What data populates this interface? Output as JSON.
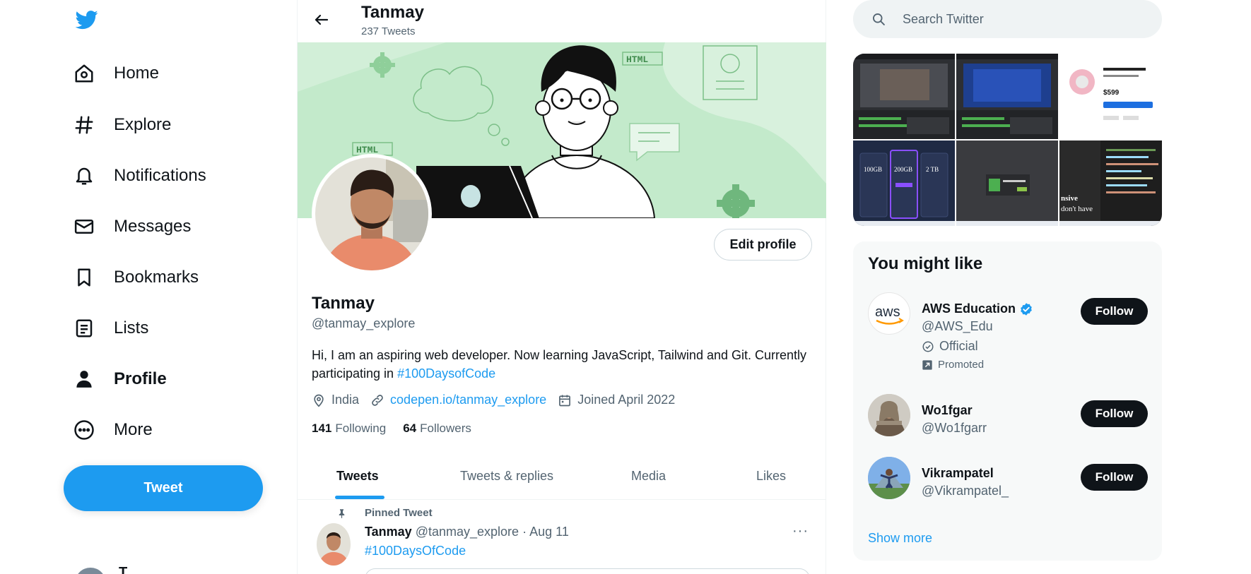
{
  "colors": {
    "accent": "#1d9bf0",
    "text": "#0f1419",
    "secondary_text": "#536471",
    "banner": "#c3eacb",
    "follow_button": "#0f1419"
  },
  "sidebar": {
    "logo_icon": "twitter-bird-icon",
    "items": [
      {
        "label": "Home",
        "icon": "home-icon"
      },
      {
        "label": "Explore",
        "icon": "hashtag-icon"
      },
      {
        "label": "Notifications",
        "icon": "bell-icon"
      },
      {
        "label": "Messages",
        "icon": "envelope-icon"
      },
      {
        "label": "Bookmarks",
        "icon": "bookmark-icon"
      },
      {
        "label": "Lists",
        "icon": "list-icon"
      },
      {
        "label": "Profile",
        "icon": "person-icon",
        "active": true
      },
      {
        "label": "More",
        "icon": "more-circle-icon"
      }
    ],
    "tweet_button": "Tweet",
    "account_name": "T"
  },
  "header": {
    "title": "Tanmay",
    "subtitle": "237 Tweets"
  },
  "banner_text": {
    "tag_1": "HTML",
    "tag_2": "HTML"
  },
  "profile": {
    "name": "Tanmay",
    "handle": "@tanmay_explore",
    "bio_text": "Hi, I am an aspiring web developer. Now learning JavaScript, Tailwind and Git. Currently participating in ",
    "bio_hashtag": "#100DaysofCode",
    "location": "India",
    "website": "codepen.io/tanmay_explore",
    "joined": "Joined April 2022",
    "following_count": "141",
    "following_label": "Following",
    "followers_count": "64",
    "followers_label": "Followers",
    "edit_button": "Edit profile"
  },
  "tabs": [
    {
      "label": "Tweets",
      "active": true
    },
    {
      "label": "Tweets & replies"
    },
    {
      "label": "Media"
    },
    {
      "label": "Likes"
    }
  ],
  "pinned_tweet": {
    "pinned_label": "Pinned Tweet",
    "author": "Tanmay",
    "handle": "@tanmay_explore",
    "separator": "·",
    "date": "Aug 11",
    "text": "#100DaysOfCode",
    "more": "···"
  },
  "search": {
    "placeholder": "Search Twitter"
  },
  "media_thumbs": {
    "price": "$599",
    "pricing_1": "100GB",
    "pricing_2": "200GB",
    "pricing_3": "2 TB",
    "snippet_1": "nsive",
    "snippet_2": "don't have"
  },
  "you_might_like": {
    "title": "You might like",
    "accounts": [
      {
        "name": "AWS Education",
        "handle": "@AWS_Edu",
        "verified": true,
        "official_label": "Official",
        "promoted_label": "Promoted",
        "button": "Follow",
        "avatar_text": "aws"
      },
      {
        "name": "Wo1fgar",
        "handle": "@Wo1fgarr",
        "button": "Follow"
      },
      {
        "name": "Vikrampatel",
        "handle": "@Vikrampatel_",
        "button": "Follow"
      }
    ],
    "show_more": "Show more"
  }
}
